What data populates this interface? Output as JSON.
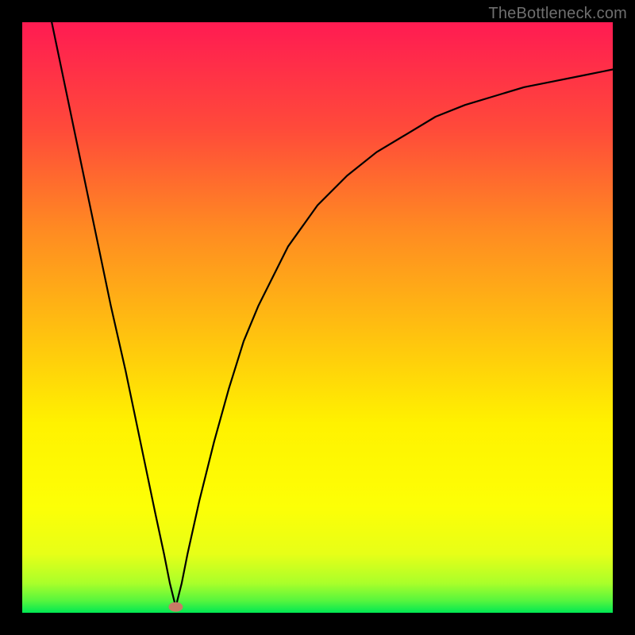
{
  "attribution": "TheBottleneck.com",
  "chart_data": {
    "type": "line",
    "title": "",
    "xlabel": "",
    "ylabel": "",
    "xlim": [
      0,
      100
    ],
    "ylim": [
      0,
      100
    ],
    "grid": false,
    "legend": false,
    "background_gradient": {
      "top_color": "#ff1b52",
      "mid_colors": [
        "#ff6a2b",
        "#ffb316",
        "#fff200",
        "#dfff1a"
      ],
      "bottom_color": "#00e853",
      "description": "Vertical gradient from red (top) through orange and yellow to green (bottom)"
    },
    "minimum_point": {
      "x": 26,
      "y": 1
    },
    "marker": {
      "shape": "ellipse",
      "color": "#c77b66",
      "x": 26,
      "y": 1
    },
    "series": [
      {
        "name": "curve",
        "stroke": "#000000",
        "stroke_width": 2,
        "x": [
          5,
          7.5,
          10,
          12.5,
          15,
          17.5,
          20,
          22.5,
          24,
          25,
          26,
          27,
          28,
          30,
          32.5,
          35,
          37.5,
          40,
          45,
          50,
          55,
          60,
          65,
          70,
          75,
          80,
          85,
          90,
          95,
          100
        ],
        "y": [
          100,
          88,
          76,
          64,
          52,
          41,
          29,
          17,
          10,
          5,
          1,
          5,
          10,
          19,
          29,
          38,
          46,
          52,
          62,
          69,
          74,
          78,
          81,
          84,
          86,
          87.5,
          89,
          90,
          91,
          92
        ]
      }
    ],
    "annotations": []
  }
}
